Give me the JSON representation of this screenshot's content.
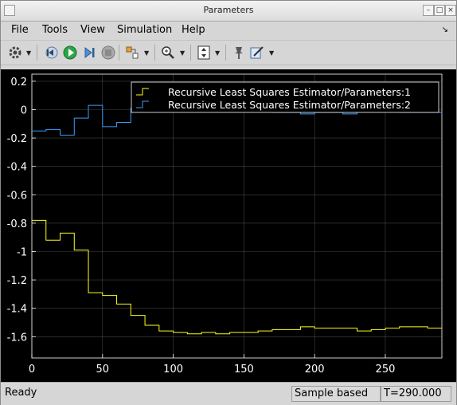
{
  "window": {
    "title": "Parameters"
  },
  "menu": {
    "file": "File",
    "tools": "Tools",
    "view": "View",
    "simulation": "Simulation",
    "help": "Help"
  },
  "toolbar": {
    "buttons": [
      "settings-icon",
      "step-back-icon",
      "run-icon",
      "step-forward-icon",
      "stop-icon",
      "highlight-icon",
      "zoom-icon",
      "autoscale-icon",
      "pin-icon",
      "style-icon"
    ]
  },
  "status": {
    "ready": "Ready",
    "mode": "Sample based",
    "time": "T=290.000"
  },
  "colors": {
    "series1": "#ffff1a",
    "series2": "#3d9bff",
    "axes": "#ffffff",
    "background": "#000000",
    "grid": "#707070"
  },
  "chart_data": {
    "type": "line",
    "step": true,
    "title": "",
    "xlabel": "",
    "ylabel": "",
    "xlim": [
      0,
      290
    ],
    "ylim": [
      -1.75,
      0.25
    ],
    "xticks": [
      0,
      50,
      100,
      150,
      200,
      250
    ],
    "yticks": [
      0.2,
      0,
      -0.2,
      -0.4,
      -0.6,
      -0.8,
      -1,
      -1.2,
      -1.4,
      -1.6
    ],
    "grid": true,
    "legend": "top-right",
    "series": [
      {
        "name": "Recursive Least Squares Estimator/Parameters:1",
        "points": [
          [
            0,
            -0.78
          ],
          [
            10,
            -0.92
          ],
          [
            20,
            -0.87
          ],
          [
            30,
            -0.99
          ],
          [
            40,
            -1.29
          ],
          [
            50,
            -1.31
          ],
          [
            60,
            -1.37
          ],
          [
            70,
            -1.45
          ],
          [
            80,
            -1.52
          ],
          [
            90,
            -1.56
          ],
          [
            100,
            -1.57
          ],
          [
            110,
            -1.58
          ],
          [
            120,
            -1.57
          ],
          [
            130,
            -1.58
          ],
          [
            140,
            -1.57
          ],
          [
            150,
            -1.57
          ],
          [
            160,
            -1.56
          ],
          [
            170,
            -1.55
          ],
          [
            180,
            -1.55
          ],
          [
            190,
            -1.53
          ],
          [
            200,
            -1.54
          ],
          [
            210,
            -1.54
          ],
          [
            220,
            -1.54
          ],
          [
            230,
            -1.56
          ],
          [
            240,
            -1.55
          ],
          [
            250,
            -1.54
          ],
          [
            260,
            -1.53
          ],
          [
            270,
            -1.53
          ],
          [
            280,
            -1.54
          ],
          [
            290,
            -1.54
          ]
        ]
      },
      {
        "name": "Recursive Least Squares Estimator/Parameters:2",
        "points": [
          [
            0,
            -0.15
          ],
          [
            10,
            -0.14
          ],
          [
            20,
            -0.18
          ],
          [
            30,
            -0.06
          ],
          [
            40,
            0.03
          ],
          [
            50,
            -0.12
          ],
          [
            60,
            -0.09
          ],
          [
            70,
            0.01
          ],
          [
            80,
            -0.01
          ],
          [
            90,
            -0.01
          ],
          [
            100,
            -0.01
          ],
          [
            110,
            -0.01
          ],
          [
            120,
            -0.01
          ],
          [
            130,
            -0.01
          ],
          [
            140,
            -0.01
          ],
          [
            150,
            -0.01
          ],
          [
            160,
            -0.01
          ],
          [
            170,
            -0.02
          ],
          [
            180,
            -0.02
          ],
          [
            190,
            -0.03
          ],
          [
            200,
            -0.02
          ],
          [
            210,
            -0.02
          ],
          [
            220,
            -0.03
          ],
          [
            230,
            -0.01
          ],
          [
            240,
            -0.01
          ],
          [
            250,
            -0.01
          ],
          [
            260,
            -0.02
          ],
          [
            270,
            -0.02
          ],
          [
            280,
            -0.02
          ],
          [
            290,
            -0.02
          ]
        ]
      }
    ]
  }
}
